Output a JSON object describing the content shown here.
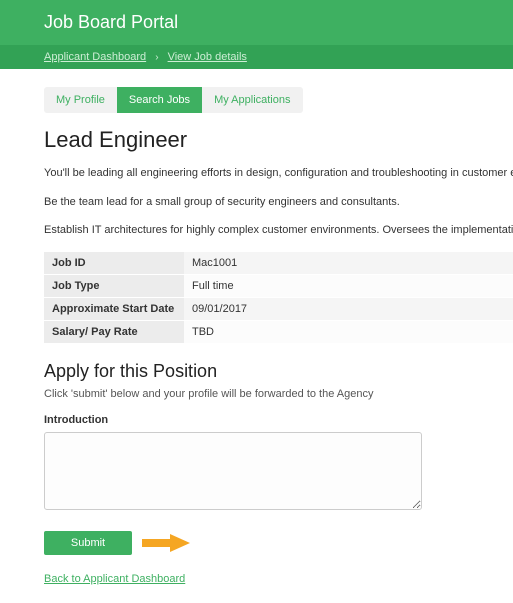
{
  "header": {
    "title": "Job Board Portal",
    "breadcrumb": {
      "dashboard": "Applicant Dashboard",
      "current": "View Job details"
    }
  },
  "tabs": {
    "profile": "My Profile",
    "search": "Search Jobs",
    "apps": "My Applications"
  },
  "job": {
    "title": "Lead Engineer",
    "desc1": "You'll be leading all engineering efforts in design, configuration and troubleshooting in customer environments of medium and large scale validation testing and network incidents.",
    "desc2": "Be the team lead for a small group of security engineers and consultants.",
    "desc3": "Establish IT architectures for highly complex customer environments. Oversees the implementation of environments utilizing best practices.",
    "details": [
      {
        "label": "Job ID",
        "value": "Mac1001"
      },
      {
        "label": "Job Type",
        "value": "Full time"
      },
      {
        "label": "Approximate Start Date",
        "value": "09/01/2017"
      },
      {
        "label": "Salary/ Pay Rate",
        "value": "TBD"
      }
    ]
  },
  "apply": {
    "title": "Apply for this Position",
    "hint": "Click 'submit' below and your profile will be forwarded to the Agency",
    "intro_label": "Introduction",
    "submit": "Submit"
  },
  "back_link": "Back to Applicant Dashboard"
}
